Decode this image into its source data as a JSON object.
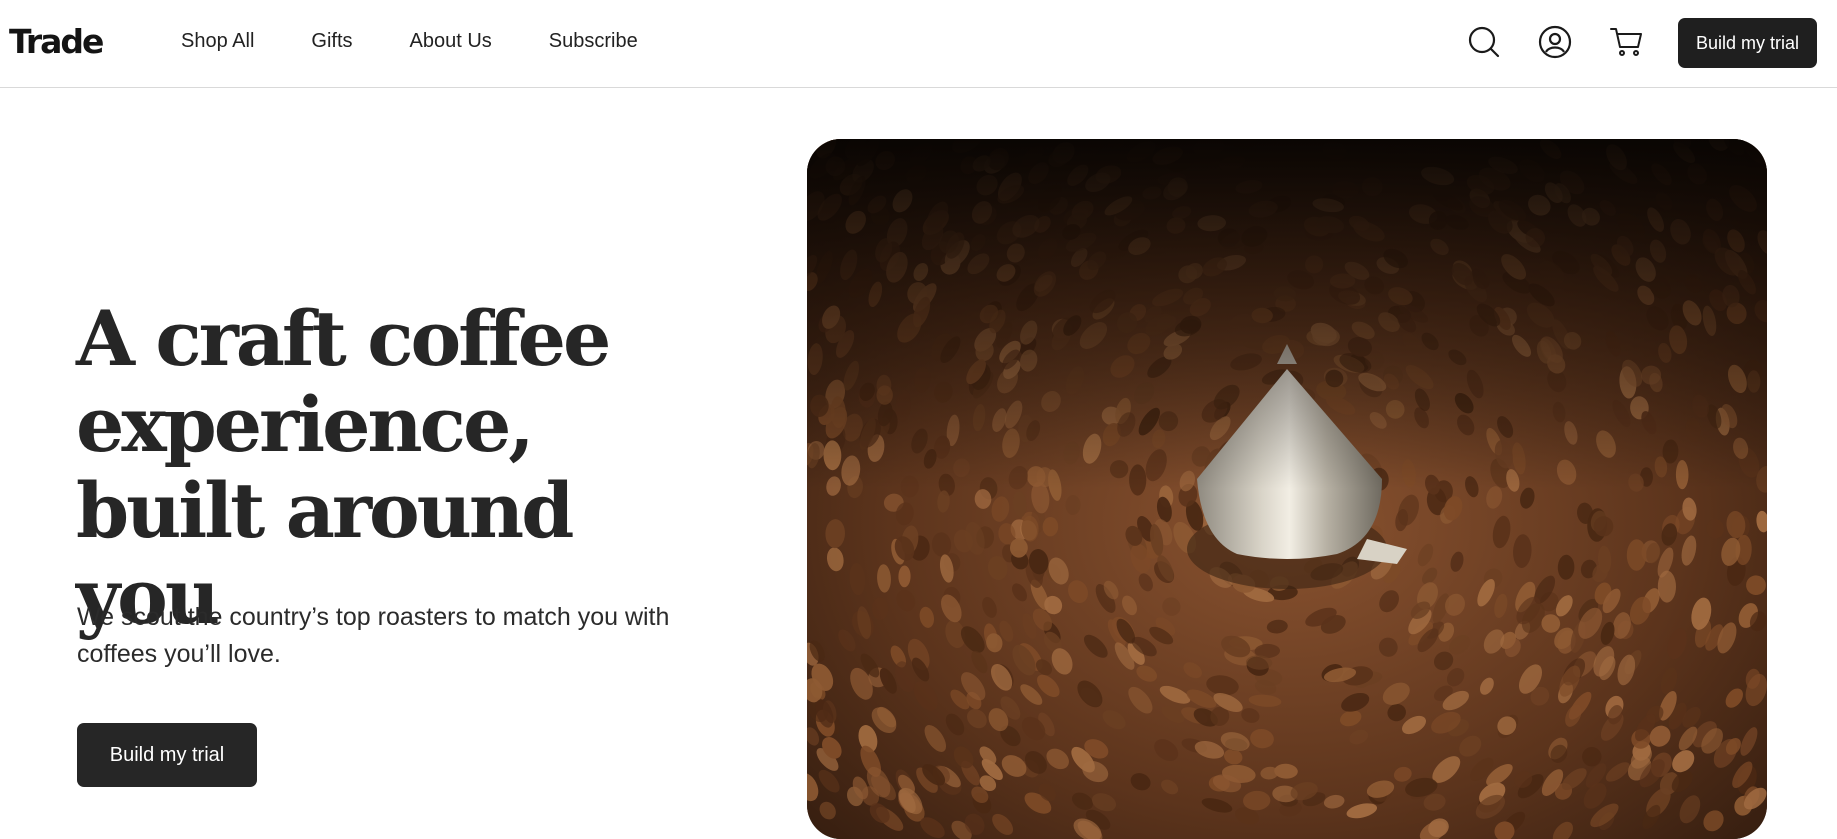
{
  "brand": {
    "logo_text": "Trade"
  },
  "nav": {
    "items": [
      {
        "label": "Shop All"
      },
      {
        "label": "Gifts"
      },
      {
        "label": "About Us"
      },
      {
        "label": "Subscribe"
      }
    ]
  },
  "header_actions": {
    "icons": [
      "search-icon",
      "account-icon",
      "cart-icon"
    ],
    "cta_label": "Build my trial"
  },
  "hero": {
    "title": "A craft coffee experience, built around you",
    "subtitle": "We scout the country’s top roasters to match you with coffees you’ll love.",
    "cta_label": "Build my trial",
    "media": "video of coffee beans swirling around a metal roaster cone"
  },
  "colors": {
    "text": "#222222",
    "button_bg": "#1f1f1f",
    "button_text": "#ffffff",
    "border": "#d9d9d9",
    "bean_brown": "#6b3f22"
  }
}
